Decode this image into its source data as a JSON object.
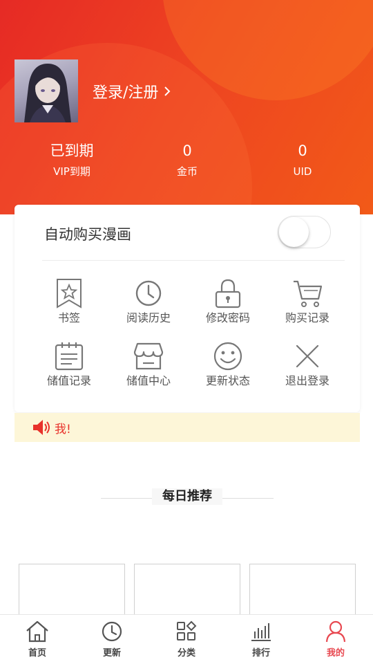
{
  "profile": {
    "login_label": "登录/注册"
  },
  "stats": [
    {
      "value": "已到期",
      "label": "VIP到期"
    },
    {
      "value": "0",
      "label": "金币"
    },
    {
      "value": "0",
      "label": "UID"
    }
  ],
  "settings": {
    "auto_buy_label": "自动购买漫画",
    "auto_buy_enabled": false
  },
  "menu": [
    {
      "label": "书签",
      "icon": "bookmark-icon"
    },
    {
      "label": "阅读历史",
      "icon": "clock-icon"
    },
    {
      "label": "修改密码",
      "icon": "lock-icon"
    },
    {
      "label": "购买记录",
      "icon": "cart-icon"
    },
    {
      "label": "储值记录",
      "icon": "calendar-list-icon"
    },
    {
      "label": "储值中心",
      "icon": "store-icon"
    },
    {
      "label": "更新状态",
      "icon": "smile-icon"
    },
    {
      "label": "退出登录",
      "icon": "close-icon"
    }
  ],
  "notice": {
    "text": "我!"
  },
  "daily": {
    "title": "每日推荐"
  },
  "tabbar": [
    {
      "label": "首页",
      "icon": "home-icon",
      "active": false
    },
    {
      "label": "更新",
      "icon": "clock-icon",
      "active": false
    },
    {
      "label": "分类",
      "icon": "category-icon",
      "active": false
    },
    {
      "label": "排行",
      "icon": "ranking-icon",
      "active": false
    },
    {
      "label": "我的",
      "icon": "user-icon",
      "active": true
    }
  ],
  "colors": {
    "brand_red": "#e62a25",
    "brand_orange": "#f25a18",
    "active_tab": "#e84850",
    "notice_bg": "#fdf6d8"
  }
}
